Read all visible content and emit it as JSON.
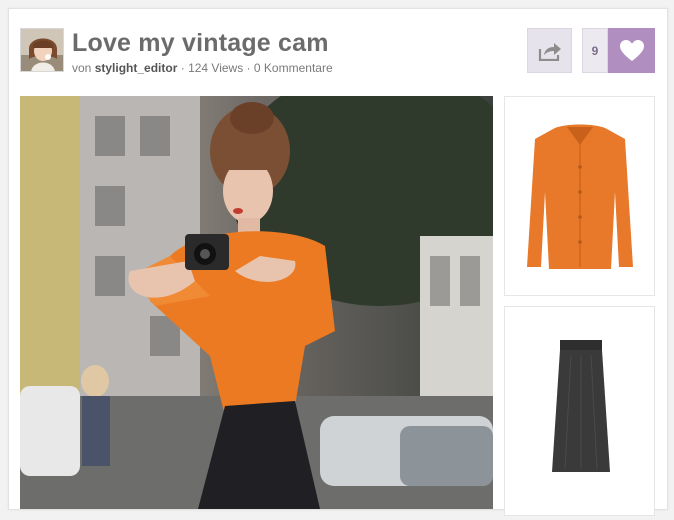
{
  "post": {
    "title": "Love my vintage cam",
    "by_prefix": "von",
    "author": "stylight_editor",
    "separator": "·",
    "views": "124 Views",
    "comments": "0 Kommentare"
  },
  "actions": {
    "share_icon": "share-arrow-icon",
    "like_count": "9",
    "like_icon": "heart-icon"
  },
  "products": [
    {
      "name": "orange-blouse",
      "color": "#e8782a"
    },
    {
      "name": "black-maxi-skirt",
      "color": "#3a3a3a"
    }
  ],
  "colors": {
    "accent": "#b08ebf",
    "title": "#6b6b6b",
    "meta": "#7a7a7a"
  }
}
